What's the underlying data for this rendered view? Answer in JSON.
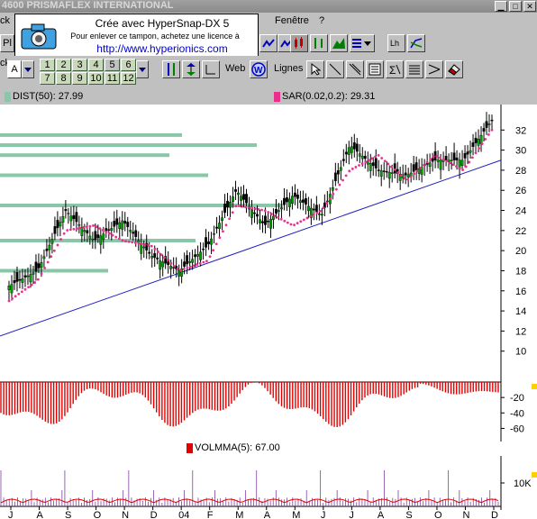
{
  "window": {
    "title": "4600  PRISMAFLEX INTERNATIONAL",
    "left_fragment": "ck"
  },
  "menu": {
    "items": [
      "Fenêtre",
      "?"
    ]
  },
  "toolbar1": {
    "left_fragment": "Pl"
  },
  "toolbar2": {
    "font_letter": "A",
    "numbers_row1": [
      "1",
      "2",
      "3",
      "4",
      "5",
      "6"
    ],
    "numbers_row2": [
      "7",
      "8",
      "9",
      "10",
      "11",
      "12"
    ],
    "web_label": "Web",
    "lignes_label": "Lignes",
    "lines_left_fragment": "ck"
  },
  "stamp": {
    "line1": "Crée avec HyperSnap-DX 5",
    "line2": "Pour enlever ce tampon, achetez une licence à",
    "line3": "http://www.hyperionics.com"
  },
  "indicators": {
    "dist": {
      "label": "DIST(50): 27.99",
      "color": "#88c8a8"
    },
    "sar": {
      "label": "SAR(0.02,0.2): 29.31",
      "color": "#e8308c"
    },
    "volmma": {
      "label": "VOLMMA(5): 67.00",
      "color": "#e00000"
    }
  },
  "price_axis": {
    "ticks": [
      "32",
      "30",
      "28",
      "26",
      "24",
      "22",
      "20",
      "18",
      "16",
      "14",
      "12",
      "10"
    ]
  },
  "oscillator_axis": {
    "ticks": [
      "-20",
      "-40",
      "-60"
    ]
  },
  "volume_axis": {
    "ticks": [
      "10K"
    ]
  },
  "time_axis": {
    "labels": [
      "J",
      "A",
      "S",
      "O",
      "N",
      "D",
      "04",
      "F",
      "M",
      "A",
      "M",
      "J",
      "J",
      "A",
      "S",
      "O",
      "N",
      "D"
    ]
  },
  "chart_data": {
    "type": "line",
    "title": "",
    "xlabel": "",
    "ylabel": "",
    "ylim": [
      8,
      34
    ],
    "categories": [
      "J",
      "A",
      "S",
      "O",
      "N",
      "D",
      "04",
      "F",
      "M",
      "A",
      "M",
      "J",
      "J",
      "A",
      "S",
      "O",
      "N",
      "D"
    ],
    "series": [
      {
        "name": "",
        "values": [
          16.5,
          18.0,
          24.0,
          21.0,
          23.0,
          19.5,
          18.0,
          20.5,
          26.0,
          22.5,
          25.5,
          23.5,
          30.5,
          28.0,
          27.5,
          29.0,
          29.0,
          33.0
        ]
      },
      {
        "name": "SAR(0.02,0.2)",
        "values": [
          15.0,
          17.0,
          22.0,
          22.5,
          21.0,
          20.5,
          18.0,
          19.0,
          24.5,
          24.0,
          22.5,
          24.0,
          28.0,
          29.5,
          27.0,
          29.5,
          28.0,
          32.0
        ]
      }
    ],
    "volume_profile": [
      18.0,
      21.0,
      24.5,
      27.5,
      29.5,
      30.5,
      31.5
    ],
    "oscillator_ylim": [
      -70,
      0
    ],
    "volume_label": "10K"
  },
  "colors": {
    "toolbar_bg": "#c0c0c0",
    "price_body": "#00a000",
    "sar": "#e8308c",
    "trendline": "#2020c0",
    "profile": "#88c8a8",
    "oscillator": "#e00000",
    "volume_line": "#8040a0"
  }
}
